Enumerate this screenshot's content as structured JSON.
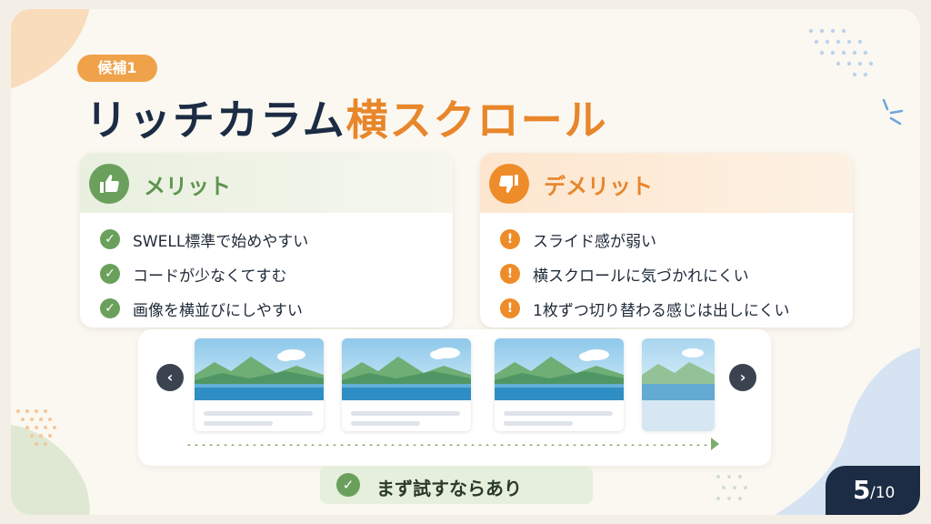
{
  "badge": "候補1",
  "title": {
    "main": "リッチカラム",
    "accent": "横スクロール"
  },
  "merit": {
    "icon": "thumbs-up-icon",
    "heading": "メリット",
    "items": [
      "SWELL標準で始めやすい",
      "コードが少なくてすむ",
      "画像を横並びにしやすい"
    ]
  },
  "demerit": {
    "icon": "thumbs-down-icon",
    "heading": "デメリット",
    "items": [
      "スライド感が弱い",
      "横スクロールに気づかれにくい",
      "1枚ずつ切り替わる感じは出しにくい"
    ]
  },
  "carousel": {
    "prev_icon": "chevron-left-icon",
    "next_icon": "chevron-right-icon",
    "card_image": "landscape-image"
  },
  "verdict": "まず試すならあり",
  "pager": {
    "current": "5",
    "total": "/10"
  },
  "colors": {
    "navy": "#1b2c44",
    "orange": "#e8862a",
    "green": "#6aa05c"
  }
}
